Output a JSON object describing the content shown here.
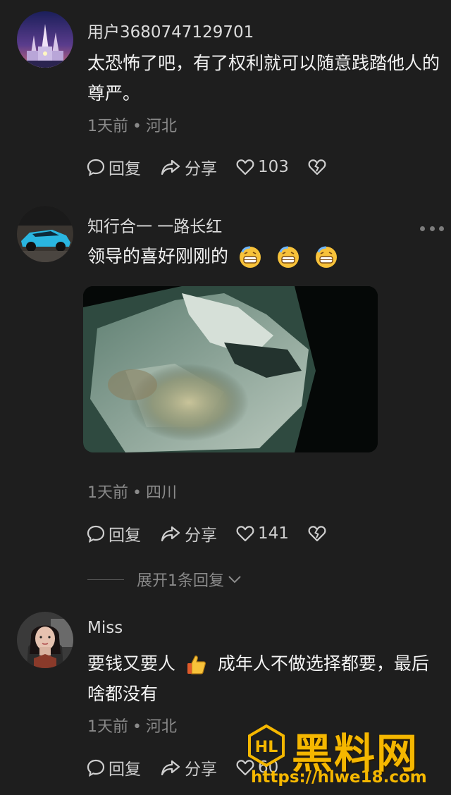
{
  "comments": [
    {
      "username": "用户3680747129701",
      "text": "太恐怖了吧，有了权利就可以随意践踏他人的尊严。",
      "time": "1天前",
      "location": "河北",
      "reply_label": "回复",
      "share_label": "分享",
      "likes": "103",
      "avatar_icon": "castle-avatar"
    },
    {
      "username": "知行合一 一路长红",
      "text": "领导的喜好刚刚的",
      "emojis": [
        "grinning-sweat-emoji",
        "grinning-sweat-emoji",
        "grinning-sweat-emoji"
      ],
      "time": "1天前",
      "location": "四川",
      "reply_label": "回复",
      "share_label": "分享",
      "likes": "141",
      "avatar_icon": "sports-car-avatar",
      "expand_label": "展开1条回复"
    },
    {
      "username": "Miss",
      "text_before_emoji": "要钱又要人",
      "text_after_emoji": "成年人不做选择都要，最后啥都没有",
      "emoji": "thumbs-up-emoji",
      "time": "1天前",
      "location": "河北",
      "reply_label": "回复",
      "share_label": "分享",
      "likes": "60",
      "avatar_icon": "woman-avatar"
    }
  ],
  "separator": "•",
  "watermark": {
    "text": "黑料网",
    "url": "https://hlwe18.com",
    "logo": "HL"
  },
  "colors": {
    "background": "#1e1e1e",
    "watermark": "#f5b700",
    "meta": "#8a8a8a"
  }
}
